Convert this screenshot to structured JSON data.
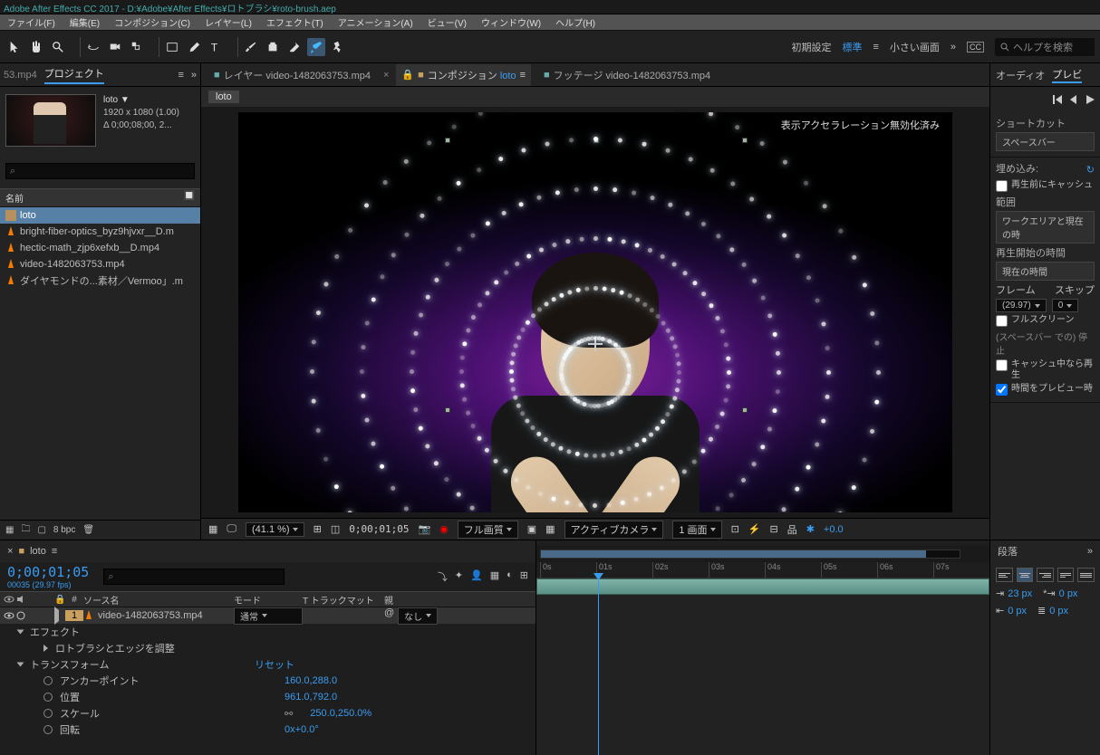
{
  "app": {
    "title": "Adobe After Effects CC 2017 - D:¥Adobe¥After Effects¥ロトブラシ¥roto-brush.aep"
  },
  "menu": [
    "ファイル(F)",
    "編集(E)",
    "コンポジション(C)",
    "レイヤー(L)",
    "エフェクト(T)",
    "アニメーション(A)",
    "ビュー(V)",
    "ウィンドウ(W)",
    "ヘルプ(H)"
  ],
  "toolbar_right": {
    "reset": "初期設定",
    "standard": "標準",
    "small": "小さい画面",
    "search_placeholder": "ヘルプを検索"
  },
  "project": {
    "tab_53": "53.mp4",
    "tab_project": "プロジェクト",
    "comp_name": "loto ▼",
    "comp_res": "1920 x 1080 (1.00)",
    "comp_dur": "Δ 0;00;08;00, 2...",
    "col_name": "名前",
    "items": [
      {
        "name": "loto",
        "type": "comp",
        "selected": true
      },
      {
        "name": "bright-fiber-optics_byz9hjvxr__D.m",
        "type": "vid"
      },
      {
        "name": "hectic-math_zjp6xefxb__D.mp4",
        "type": "vid"
      },
      {
        "name": "video-1482063753.mp4",
        "type": "vid"
      },
      {
        "name": "ダイヤモンドの...素材／Vermoo」.m",
        "type": "vid"
      }
    ],
    "bpc": "8 bpc"
  },
  "comp_panel": {
    "tabs": [
      {
        "label": "レイヤー video-1482063753.mp4",
        "active": false
      },
      {
        "label": "コンポジション loto",
        "active": true,
        "comp": true
      },
      {
        "label": "フッテージ video-1482063753.mp4",
        "active": false
      }
    ],
    "subtab": "loto",
    "accel_note": "表示アクセラレーション無効化済み",
    "footer": {
      "zoom": "(41.1 %)",
      "timecode": "0;00;01;05",
      "quality": "フル画質",
      "camera": "アクティブカメラ",
      "views": "1 画面",
      "exposure": "+0.0"
    }
  },
  "right_panel": {
    "tab_audio": "オーディオ",
    "tab_preview": "プレビ",
    "shortcut_title": "ショートカット",
    "shortcut_val": "スペースバー",
    "include_title": "埋め込み:",
    "chk_cache": "再生前にキャッシュ",
    "range_lbl": "範囲",
    "range_val": "ワークエリアと現在の時",
    "playfrom_title": "再生開始の時間",
    "playfrom_val": "現在の時間",
    "frame_lbl": "フレーム",
    "skip_lbl": "スキップ",
    "fps": "(29.97)",
    "skip_val": "0",
    "chk_fullscreen": "フルスクリーン",
    "note_stop": "(スペースバー での) 停止",
    "chk_cache_play": "キャッシュ中なら再生",
    "chk_time_preview": "時間をプレビュー時"
  },
  "timeline": {
    "tab": "loto",
    "timecode": "0;00;01;05",
    "frames": "00035 (29.97 fps)",
    "cols": {
      "num": "#",
      "source": "ソース名",
      "mode": "モード",
      "trkmat": "T  トラックマット",
      "parent": "親"
    },
    "layers": [
      {
        "num": "1",
        "name": "video-1482063753.mp4",
        "mode": "通常",
        "parent": "なし"
      }
    ],
    "groups": {
      "effects": "エフェクト",
      "roto": "ロトブラシとエッジを調整",
      "transform": "トランスフォーム",
      "reset": "リセット",
      "anchor": "アンカーポイント",
      "anchor_v": "160.0,288.0",
      "position": "位置",
      "position_v": "961.0,792.0",
      "scale": "スケール",
      "scale_v": "250.0,250.0%",
      "rotation": "回転",
      "rotation_v": "0x+0.0°"
    },
    "ruler": [
      "0s",
      "01s",
      "02s",
      "03s",
      "04s",
      "05s",
      "06s",
      "07s"
    ]
  },
  "paragraph_panel": {
    "title": "段落",
    "indent1": "23 px",
    "indent2": "0 px",
    "indent3": "0 px",
    "indent4": "0 px"
  }
}
